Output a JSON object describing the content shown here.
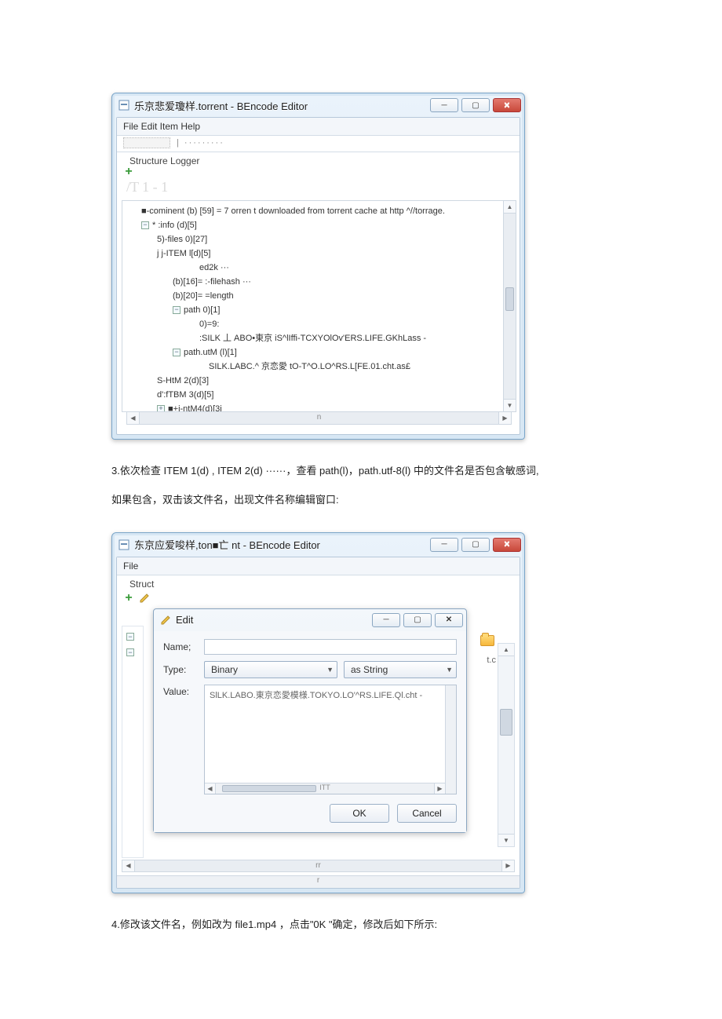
{
  "win1": {
    "title": "乐京悲爱瓊样.torrent - BEncode Editor",
    "menubar": "File Edit Item Help",
    "tabs": "Structure Logger",
    "big_faded": "/T 1 - 1",
    "tree": {
      "r1": "■-cominent (b) [59] = 7 orren t downloaded from torrent cache at http ^//torrage.",
      "r2": "* :info (d)[5]",
      "r3": "5)-files 0)[27]",
      "r4": "j j-ITEM l[d)[5]",
      "r5": "ed2k   ···",
      "r6": "(b)[16]= :-filehash   ···",
      "r7": "(b)[20]= =length",
      "r8": "path 0)[1]",
      "r8b": "0)=9:",
      "r9": ":SILK 丄 ABO•東京 iS^lIffi-TCXYOlOv'ERS.LIFE.GKhLass -",
      "r10": "path.utM       (l)[1]",
      "r11": "SILK.LABC.^ 京恋愛 tO-T^O.LO^RS.L[FE.01.cht.as£",
      "r12": "S-HtM 2(d)[3]",
      "r13": "d':fTBM 3(d)[5]",
      "r14": "■+i-ntM4(d)[3j"
    },
    "hlabel": "n"
  },
  "para1": "3.依次检查 ITEM 1(d) , ITEM 2(d)             ······，查看 path(l)，path.utf-8(l)        中的文件名是否包含敏感词,",
  "para2": "如果包含，双击该文件名，出现文件名称编辑窗口:",
  "win2": {
    "title": "东京应爱唆样,ton■亡 nt - BEncode Editor",
    "menubar": "File",
    "tabs_prefix": "Struct",
    "hlabel": "rr",
    "hlabel_outer": "r",
    "right_letters": "t.c"
  },
  "edit": {
    "title": "Edit",
    "name_label": "Name;",
    "type_label": "Type:",
    "type_value": "Binary",
    "as_value": "as String",
    "value_label": "Value:",
    "value_text": "SlLK.LABO.東京恋愛模様.TOKYO.LO'^RS.LIFE.Ql.cht -",
    "mlabel": "ITT",
    "ok": "OK",
    "cancel": "Cancel"
  },
  "para3": "4.修改该文件名，例如改为        file1.mp4  ，点击\"0K \"确定，修改后如下所示:"
}
